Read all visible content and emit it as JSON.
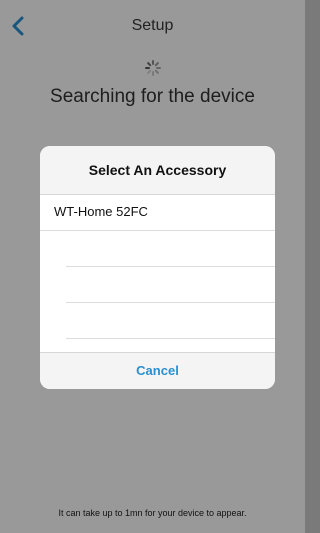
{
  "nav": {
    "title": "Setup"
  },
  "status": {
    "searching_text": "Searching for the device"
  },
  "dialog": {
    "title": "Select An Accessory",
    "items": [
      {
        "label": "WT-Home 52FC"
      },
      {
        "label": ""
      },
      {
        "label": ""
      },
      {
        "label": ""
      },
      {
        "label": ""
      }
    ],
    "cancel_label": "Cancel"
  },
  "footer": {
    "note": "It can take up to 1mn for your device to appear."
  },
  "colors": {
    "accent": "#2a8fd0",
    "overlay": "rgba(0,0,0,0.40)"
  },
  "icons": {
    "back": "chevron-left-icon",
    "spinner": "spinner-icon"
  }
}
